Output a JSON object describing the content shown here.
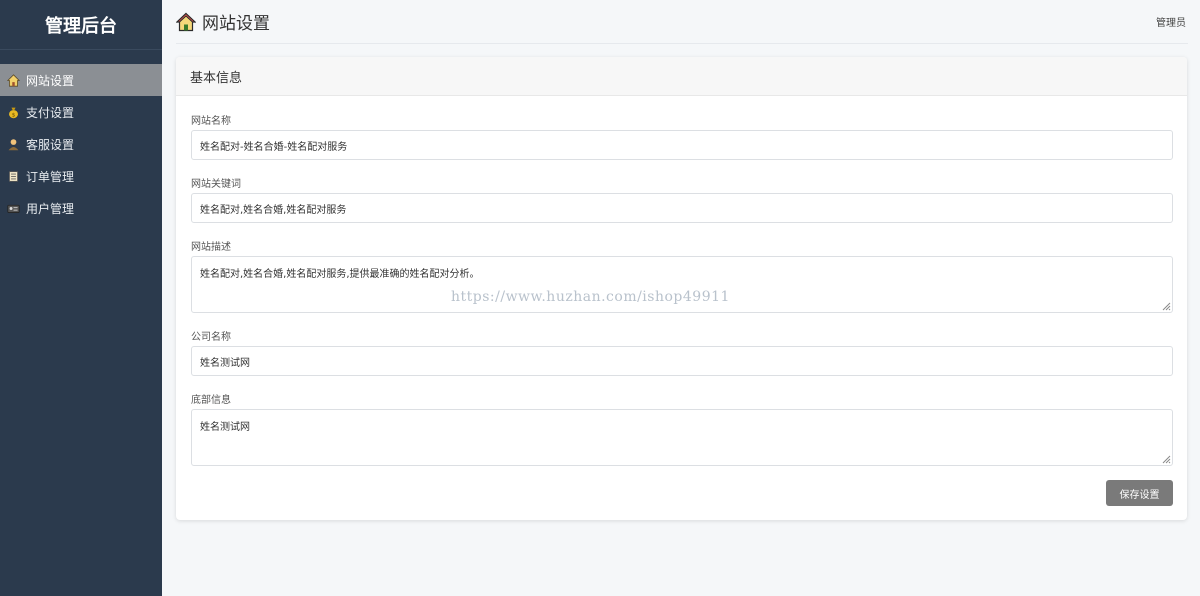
{
  "sidebar": {
    "brand": "管理后台",
    "items": [
      {
        "label": "网站设置",
        "icon": "house-icon",
        "active": true
      },
      {
        "label": "支付设置",
        "icon": "money-bag-icon",
        "active": false
      },
      {
        "label": "客服设置",
        "icon": "user-icon",
        "active": false
      },
      {
        "label": "订单管理",
        "icon": "notebook-icon",
        "active": false
      },
      {
        "label": "用户管理",
        "icon": "id-card-icon",
        "active": false
      }
    ]
  },
  "header": {
    "title": "网站设置",
    "user": "管理员"
  },
  "card": {
    "title": "基本信息",
    "fields": {
      "site_name": {
        "label": "网站名称",
        "value": "姓名配对-姓名合婚-姓名配对服务"
      },
      "keywords": {
        "label": "网站关键词",
        "value": "姓名配对,姓名合婚,姓名配对服务"
      },
      "description": {
        "label": "网站描述",
        "value": "姓名配对,姓名合婚,姓名配对服务,提供最准确的姓名配对分析。"
      },
      "company": {
        "label": "公司名称",
        "value": "姓名测试网"
      },
      "footer": {
        "label": "底部信息",
        "value": "姓名测试网"
      }
    },
    "save_label": "保存设置"
  },
  "watermark": "https://www.huzhan.com/ishop49911",
  "colors": {
    "sidebar_bg": "#2b3a4d",
    "active_item_bg": "#8b8f94",
    "save_button_bg": "#7a7a7a"
  }
}
